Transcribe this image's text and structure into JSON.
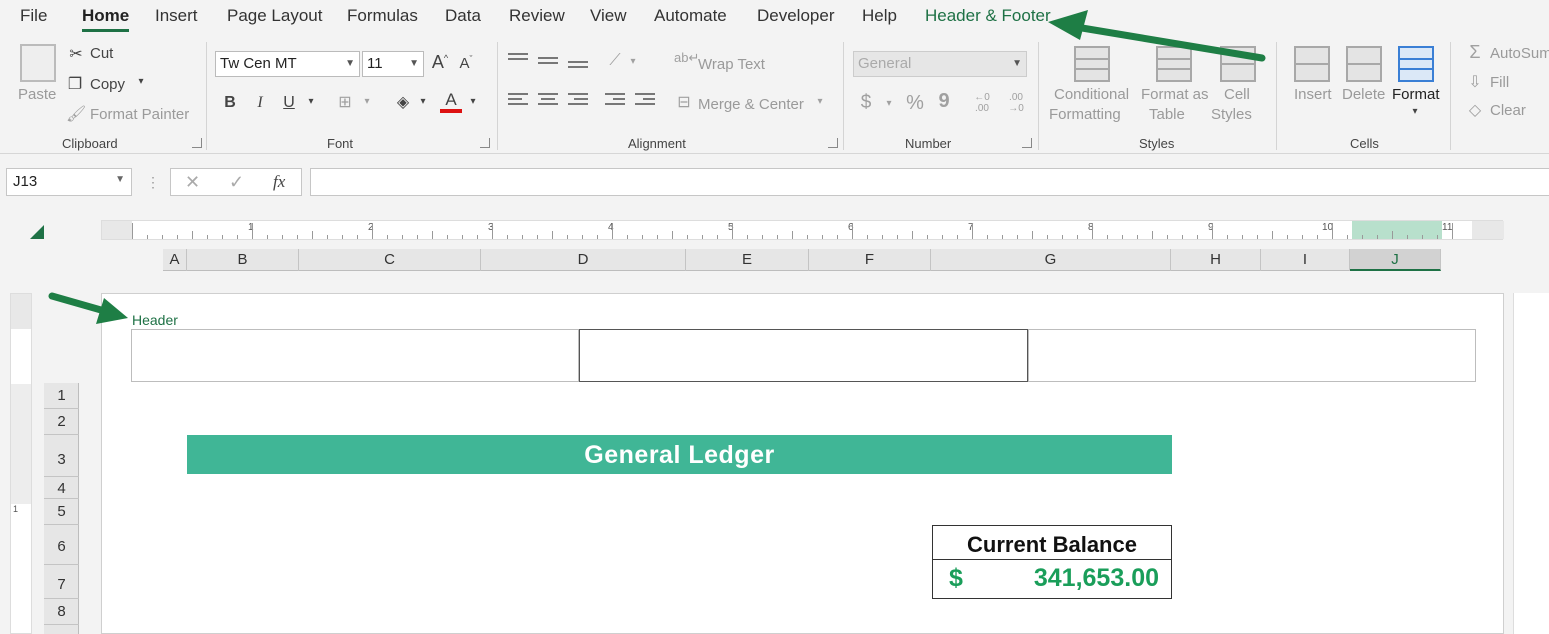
{
  "menu": {
    "tabs": [
      {
        "label": "File"
      },
      {
        "label": "Home"
      },
      {
        "label": "Insert"
      },
      {
        "label": "Page Layout"
      },
      {
        "label": "Formulas"
      },
      {
        "label": "Data"
      },
      {
        "label": "Review"
      },
      {
        "label": "View"
      },
      {
        "label": "Automate"
      },
      {
        "label": "Developer"
      },
      {
        "label": "Help"
      },
      {
        "label": "Header & Footer"
      }
    ]
  },
  "ribbon": {
    "clipboard": {
      "paste": "Paste",
      "cut": "Cut",
      "copy": "Copy",
      "format_painter": "Format Painter",
      "label": "Clipboard"
    },
    "font": {
      "name": "Tw Cen MT",
      "size": "11",
      "label": "Font",
      "bold": "B",
      "italic": "I",
      "underline": "U",
      "font_color": "A"
    },
    "alignment": {
      "wrap_text": "Wrap Text",
      "merge_center": "Merge & Center",
      "label": "Alignment"
    },
    "number": {
      "format": "General",
      "currency": "$",
      "percent": "%",
      "comma": "9",
      "inc_dec": "←0 .00",
      "dec_dec": ".00 →0",
      "label": "Number"
    },
    "styles": {
      "conditional_1": "Conditional",
      "conditional_2": "Formatting",
      "format_table_1": "Format as",
      "format_table_2": "Table",
      "cell_styles_1": "Cell",
      "cell_styles_2": "Styles",
      "label": "Styles"
    },
    "cells": {
      "insert": "Insert",
      "delete": "Delete",
      "format": "Format",
      "label": "Cells"
    },
    "editing": {
      "autosum": "AutoSum",
      "fill": "Fill",
      "clear": "Clear"
    }
  },
  "formula_bar": {
    "name_box": "J13",
    "fx": "fx",
    "formula": ""
  },
  "ruler": {
    "numbers": [
      "1",
      "2",
      "3",
      "4",
      "5",
      "6",
      "7",
      "8",
      "9",
      "10",
      "11"
    ]
  },
  "columns": [
    "A",
    "B",
    "C",
    "D",
    "E",
    "F",
    "G",
    "H",
    "I",
    "J"
  ],
  "selected_column": "J",
  "rows": [
    "1",
    "2",
    "3",
    "4",
    "5",
    "6",
    "7",
    "8"
  ],
  "vertical_ruler": {
    "mark": "1"
  },
  "page": {
    "header_label": "Header",
    "ledger_title": "General Ledger",
    "balance": {
      "title": "Current Balance",
      "currency": "$",
      "value": "341,653.00"
    }
  },
  "colors": {
    "accent": "#1e7145",
    "ledger_bg": "#40b696",
    "balance_green": "#1a9e5a"
  }
}
